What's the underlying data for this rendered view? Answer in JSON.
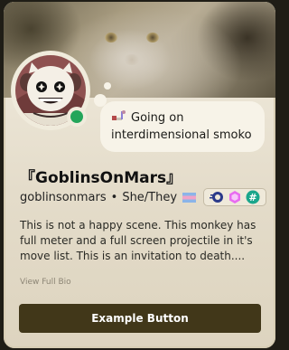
{
  "profile": {
    "display_name": "『GoblinsOnMars』",
    "username": "goblinsonmars",
    "separator": "•",
    "pronouns": "She/They",
    "online_status_color": "#23a55a"
  },
  "custom_status": {
    "emoji": "mixed-emoji-icon",
    "text": "Going on interdimensional smoko"
  },
  "badges": [
    "quest-badge-icon",
    "nitro-boost-badge-icon",
    "pomelo-hash-badge-icon"
  ],
  "bio": {
    "text": "This is not a happy scene. This monkey has full meter and a full screen projectile in it's move list. This is an invitation to death....",
    "view_full_label": "View Full Bio"
  },
  "actions": {
    "primary_label": "Example Button",
    "primary_color": "#413719"
  }
}
